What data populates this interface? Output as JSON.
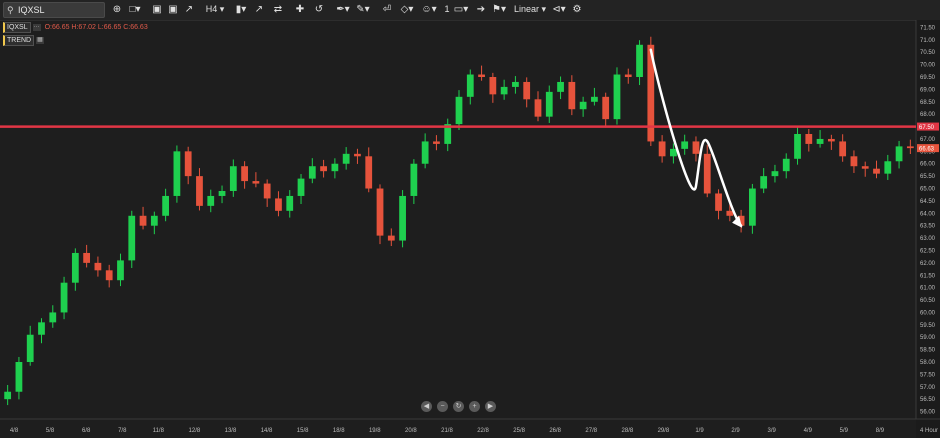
{
  "toolbar": {
    "symbol": "IQXSL",
    "timeframe": "H4",
    "line_width": "1",
    "scale": "Linear"
  },
  "legend": {
    "symbol": "IQXSL",
    "ohlc": "O:66.65 H:67.02 L:66.65 C:66.63",
    "indicator": "TREND"
  },
  "timeframe_label": "4 Hour",
  "colors": {
    "up": "#1fd04f",
    "down": "#e6533c",
    "level": "#e23645",
    "background": "#1e1e1e"
  },
  "chart_data": {
    "type": "candlestick",
    "ylim": [
      55.7,
      71.8
    ],
    "y_ticks": [
      "56.00",
      "56.50",
      "57.00",
      "57.50",
      "58.00",
      "58.50",
      "59.00",
      "59.50",
      "60.00",
      "60.50",
      "61.00",
      "61.50",
      "62.00",
      "62.50",
      "63.00",
      "63.50",
      "64.00",
      "64.50",
      "65.00",
      "65.50",
      "66.00",
      "66.50",
      "67.00",
      "67.50",
      "68.00",
      "68.50",
      "69.00",
      "69.50",
      "70.00",
      "70.50",
      "71.00",
      "71.50"
    ],
    "x_labels": [
      "4/8",
      "5/8",
      "6/8",
      "7/8",
      "11/8",
      "12/8",
      "13/8",
      "14/8",
      "15/8",
      "18/8",
      "19/8",
      "20/8",
      "21/8",
      "22/8",
      "25/8",
      "26/8",
      "27/8",
      "28/8",
      "29/8",
      "1/9",
      "2/9",
      "3/9",
      "4/9",
      "5/9",
      "8/9"
    ],
    "horizontal_level": 67.5,
    "level_label": "67.50",
    "last_price": 66.63,
    "last_price_label": "66.63",
    "close_path": [
      56.8,
      58.0,
      59.1,
      59.6,
      60.0,
      61.2,
      62.4,
      62.0,
      61.7,
      61.3,
      62.1,
      63.9,
      63.5,
      63.9,
      64.7,
      66.5,
      65.5,
      64.3,
      64.7,
      64.9,
      65.9,
      65.3,
      65.2,
      64.6,
      64.1,
      64.7,
      65.4,
      65.9,
      65.7,
      66.0,
      66.4,
      66.3,
      65.0,
      63.1,
      62.9,
      64.7,
      66.0,
      66.9,
      66.8,
      67.6,
      68.7,
      69.6,
      69.5,
      68.8,
      69.1,
      69.3,
      68.6,
      67.9,
      68.9,
      69.3,
      68.2,
      68.5,
      68.7,
      67.8,
      69.6,
      69.5,
      70.8,
      66.9,
      66.3,
      66.6,
      66.9,
      66.4,
      64.8,
      64.1,
      63.9,
      63.5,
      65.0,
      65.5,
      65.7,
      66.2,
      67.2,
      66.8,
      67.0,
      66.9,
      66.3,
      65.9,
      65.8,
      65.6,
      66.1,
      66.7,
      66.63
    ],
    "annotation": {
      "type": "arrow",
      "points": [
        [
          57,
          70.6
        ],
        [
          61,
          65.3
        ],
        [
          62,
          66.9
        ],
        [
          65,
          63.5
        ]
      ]
    }
  }
}
